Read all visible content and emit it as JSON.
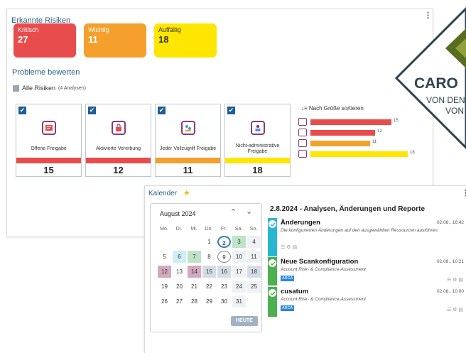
{
  "risk_panel": {
    "title": "Erkannte Risiken",
    "menu_icon": "kebab-menu-icon",
    "severity": [
      {
        "label": "Kritisch",
        "count": "27",
        "color": "#e84c4c"
      },
      {
        "label": "Wichtig",
        "count": "11",
        "color": "#f5a02d"
      },
      {
        "label": "Auffällig",
        "count": "18",
        "color": "#ffe600"
      }
    ],
    "section_title": "Probleme bewerten",
    "all_risks_label": "Alle Risiken",
    "all_risks_count": "(4 Analysen)",
    "cards": [
      {
        "label": "Offene Freigabe",
        "count": "15",
        "bar_color": "#e84c4c",
        "icon": "open-share-icon"
      },
      {
        "label": "Aktivierte Vererbung",
        "count": "12",
        "bar_color": "#e84c4c",
        "icon": "inheritance-lock-icon"
      },
      {
        "label": "Jeder Vollzugriff Freigabe",
        "count": "11",
        "bar_color": "#f5a02d",
        "icon": "everyone-share-icon"
      },
      {
        "label": "Nicht-administrative Freigabe",
        "count": "18",
        "bar_color": "#ffe600",
        "icon": "non-admin-share-icon"
      }
    ],
    "sort_label": "Nach Größe sortieren",
    "bars": [
      {
        "value": 15,
        "label": "15",
        "color": "#e84c4c"
      },
      {
        "value": 12,
        "label": "12",
        "color": "#e84c4c"
      },
      {
        "value": 11,
        "label": "11",
        "color": "#f5a02d"
      },
      {
        "value": 18,
        "label": "18",
        "color": "#ffe600"
      }
    ]
  },
  "logo": {
    "text": "CARO",
    "line2": "VON DEN",
    "line3": "VON"
  },
  "calendar": {
    "title": "Kalender",
    "menu_icon": "kebab-menu-icon",
    "month": "August 2024",
    "weekdays": [
      "Mo.",
      "Di.",
      "Mi.",
      "Do.",
      "Fr.",
      "Sa.",
      "So."
    ],
    "today_label": "HEUTE",
    "activities_title": "2.8.2024 - Analysen, Änderungen und Reporte",
    "activities": [
      {
        "title": "Änderungen",
        "desc": "Die konfigurierten Änderungen auf den ausgewählten Ressourcen ausführen.",
        "time": "02.08., 16:42",
        "stripe": "#29b6d4",
        "tag": ""
      },
      {
        "title": "Neue Scankonfiguration",
        "desc": "Account Risk- & Compliance-Assessment",
        "time": "02.08., 10:21",
        "stripe": "#4caf50",
        "tag": "ARCA"
      },
      {
        "title": "cusatum",
        "desc": "Account Risk- & Compliance-Assessment",
        "time": "02.08., 10:00",
        "stripe": "#4caf50",
        "tag": "ARCA"
      }
    ]
  }
}
